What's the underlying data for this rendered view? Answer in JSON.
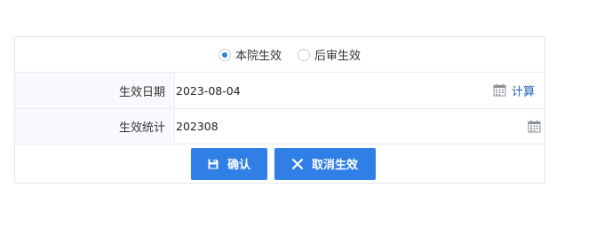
{
  "scope": {
    "options": [
      {
        "label": "本院生效",
        "selected": true
      },
      {
        "label": "后审生效",
        "selected": false
      }
    ]
  },
  "fields": {
    "effective_date": {
      "label": "生效日期",
      "value": "2023-08-04",
      "action": "计算",
      "icon": "calendar-icon"
    },
    "effective_stat": {
      "label": "生效统计",
      "value": "202308",
      "icon": "calendar-icon"
    }
  },
  "buttons": {
    "confirm": {
      "label": "确认",
      "icon": "save-icon"
    },
    "cancel": {
      "label": "取消生效",
      "icon": "close-icon"
    }
  },
  "colors": {
    "accent": "#2f7fe6",
    "label_bg": "#f7f9fc",
    "border": "#e3e6eb",
    "link": "#1f5fbf"
  }
}
